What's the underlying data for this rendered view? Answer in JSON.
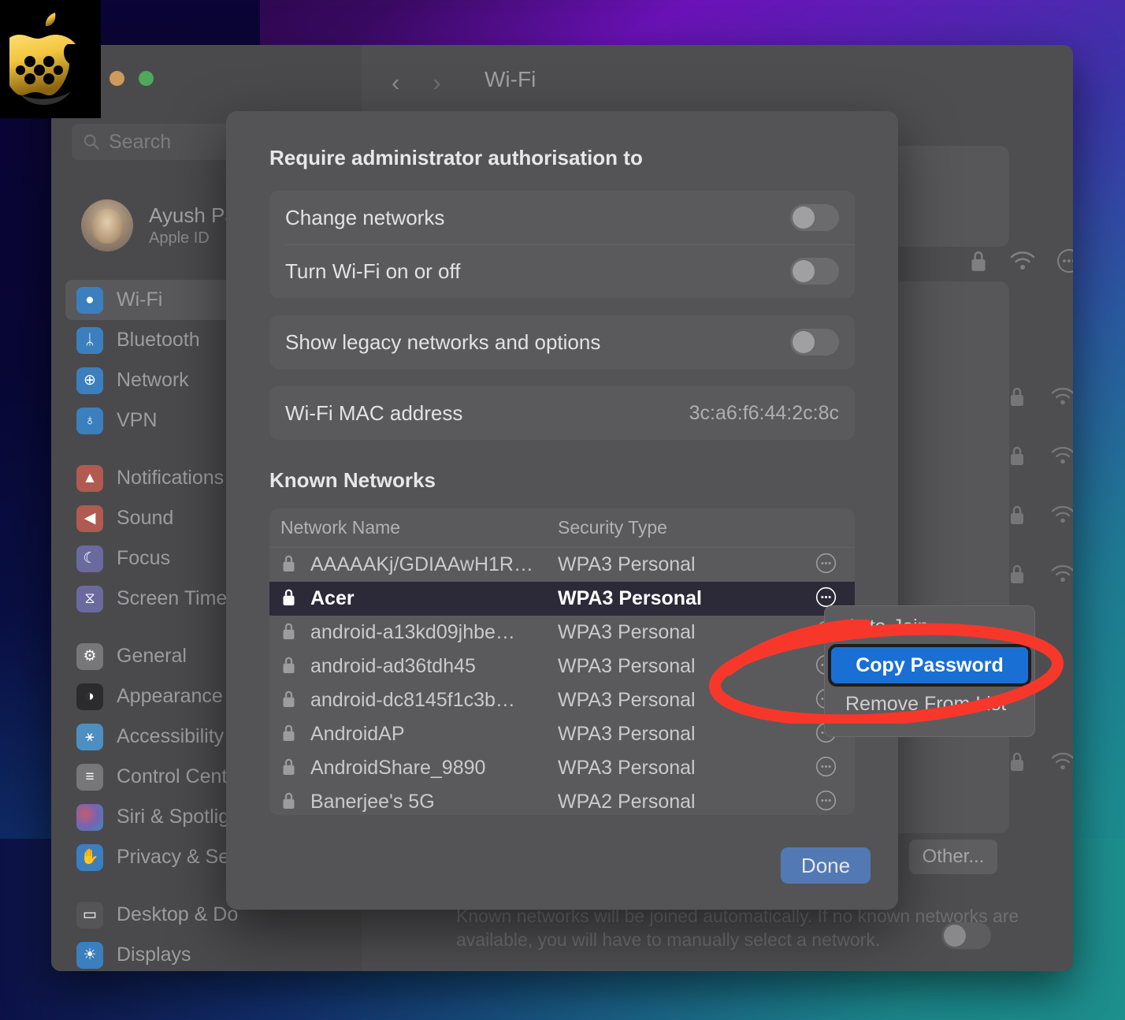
{
  "window": {
    "title": "Wi-Fi",
    "back_icon": "chevron-left-icon",
    "forward_icon": "chevron-right-icon",
    "traffic_close": "close-button",
    "traffic_minimize": "minimize-button",
    "traffic_zoom": "zoom-button"
  },
  "sidebar": {
    "search": {
      "placeholder": "Search",
      "icon": "search-icon"
    },
    "account": {
      "name": "Ayush Pat",
      "subtitle": "Apple ID"
    },
    "groups": [
      {
        "items": [
          {
            "label": "Wi-Fi",
            "icon": "wifi-icon",
            "color": "ic-blue",
            "glyph": "●",
            "selected": true
          },
          {
            "label": "Bluetooth",
            "icon": "bluetooth-icon",
            "color": "ic-blue",
            "glyph": "ᛦ",
            "selected": false
          },
          {
            "label": "Network",
            "icon": "globe-icon",
            "color": "ic-blue",
            "glyph": "⊕",
            "selected": false
          },
          {
            "label": "VPN",
            "icon": "vpn-globe-icon",
            "color": "ic-blue",
            "glyph": "♁",
            "selected": false
          }
        ]
      },
      {
        "items": [
          {
            "label": "Notifications",
            "icon": "bell-icon",
            "color": "ic-red",
            "glyph": "▲",
            "selected": false
          },
          {
            "label": "Sound",
            "icon": "speaker-icon",
            "color": "ic-red",
            "glyph": "◀",
            "selected": false
          },
          {
            "label": "Focus",
            "icon": "moon-icon",
            "color": "ic-purp",
            "glyph": "☾",
            "selected": false
          },
          {
            "label": "Screen Time",
            "icon": "hourglass-icon",
            "color": "ic-purp",
            "glyph": "⧖",
            "selected": false
          }
        ]
      },
      {
        "items": [
          {
            "label": "General",
            "icon": "gear-icon",
            "color": "ic-gray",
            "glyph": "⚙",
            "selected": false
          },
          {
            "label": "Appearance",
            "icon": "contrast-icon",
            "color": "ic-black",
            "glyph": "◑",
            "selected": false
          },
          {
            "label": "Accessibility",
            "icon": "accessibility-icon",
            "color": "ic-cyan",
            "glyph": "⚹",
            "selected": false
          },
          {
            "label": "Control Centr",
            "icon": "control-centre-icon",
            "color": "ic-gray",
            "glyph": "≡",
            "selected": false
          },
          {
            "label": "Siri & Spotligh",
            "icon": "siri-icon",
            "color": "ic-rain",
            "glyph": "",
            "selected": false
          },
          {
            "label": "Privacy & Sec",
            "icon": "hand-icon",
            "color": "ic-blue",
            "glyph": "✋",
            "selected": false
          }
        ]
      },
      {
        "items": [
          {
            "label": "Desktop & Do",
            "icon": "desktop-dock-icon",
            "color": "ic-dark",
            "glyph": "▭",
            "selected": false
          },
          {
            "label": "Displays",
            "icon": "display-brightness-icon",
            "color": "ic-blue",
            "glyph": "☀",
            "selected": false
          }
        ]
      }
    ]
  },
  "background_pane": {
    "other_button": "Other...",
    "hint": "Known networks will be joined automatically. If no known networks are available, you will have to manually select a network."
  },
  "sheet": {
    "admin_heading": "Require administrator authorisation to",
    "admin_rows": [
      {
        "label": "Change networks",
        "toggle": "off"
      },
      {
        "label": "Turn Wi-Fi on or off",
        "toggle": "off"
      }
    ],
    "legacy_row": {
      "label": "Show legacy networks and options",
      "toggle": "off"
    },
    "mac_row": {
      "label": "Wi-Fi MAC address",
      "value": "3c:a6:f6:44:2c:8c"
    },
    "known_networks_heading": "Known Networks",
    "table": {
      "columns": [
        "Network Name",
        "Security Type"
      ],
      "rows": [
        {
          "name": "AAAAAKj/GDIAAwH1R…",
          "security": "WPA3 Personal",
          "lock": "lock-icon",
          "more": "more-options-icon",
          "selected": false
        },
        {
          "name": "Acer",
          "security": "WPA3 Personal",
          "lock": "lock-icon",
          "more": "more-options-icon",
          "selected": true
        },
        {
          "name": "android-a13kd09jhbe…",
          "security": "WPA3 Personal",
          "lock": "lock-icon",
          "more": "more-options-icon",
          "selected": false
        },
        {
          "name": "android-ad36tdh45",
          "security": "WPA3 Personal",
          "lock": "lock-icon",
          "more": "more-options-icon",
          "selected": false
        },
        {
          "name": "android-dc8145f1c3b…",
          "security": "WPA3 Personal",
          "lock": "lock-icon",
          "more": "more-options-icon",
          "selected": false
        },
        {
          "name": "AndroidAP",
          "security": "WPA3 Personal",
          "lock": "lock-icon",
          "more": "more-options-icon",
          "selected": false
        },
        {
          "name": "AndroidShare_9890",
          "security": "WPA3 Personal",
          "lock": "lock-icon",
          "more": "more-options-icon",
          "selected": false
        },
        {
          "name": "Banerjee's 5G",
          "security": "WPA2 Personal",
          "lock": "lock-icon",
          "more": "more-options-icon",
          "selected": false
        }
      ]
    },
    "done_label": "Done"
  },
  "context_menu": {
    "items": [
      {
        "label": "Auto-Join",
        "highlighted": false
      },
      {
        "label": "Copy Password",
        "highlighted": true
      },
      {
        "label": "Remove From List",
        "highlighted": false
      }
    ]
  },
  "annotation": {
    "shape": "red-ellipse-highlight",
    "color": "#f8372b"
  },
  "badge": {
    "icon": "apple-logo-icon",
    "color": "#f0c233"
  }
}
